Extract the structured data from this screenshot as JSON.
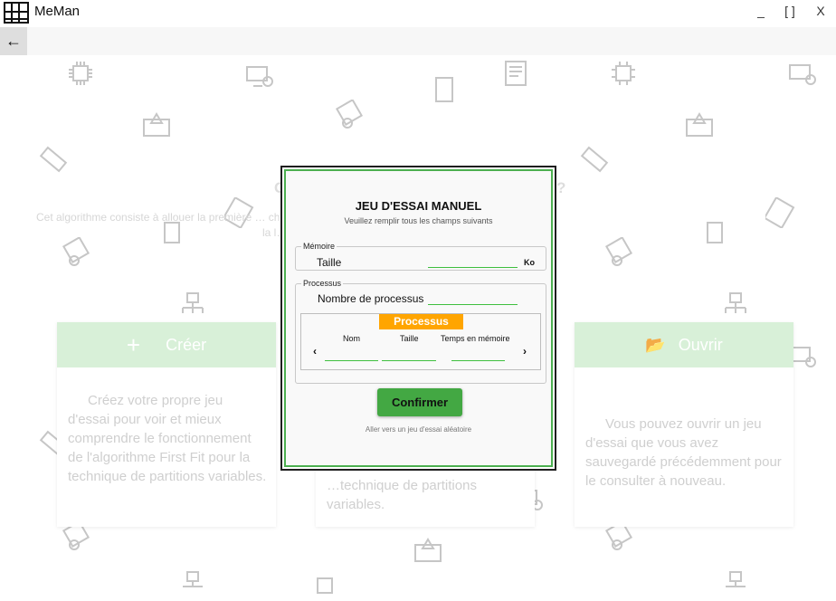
{
  "window": {
    "title": "MeMan",
    "minimize_label": "_",
    "maximize_label": "[ ]",
    "close_label": "X"
  },
  "nav": {
    "back_icon": "arrow-left-icon"
  },
  "background": {
    "heading_left": "C",
    "heading_right": "?",
    "desc_line1": "Cet algorithme consiste à allouer la première … charger en mémoire en la recherchant dans",
    "desc_line2": "la l… de."
  },
  "cards": [
    {
      "title": "Créer",
      "icon": "plus-icon",
      "body": "Créez votre propre jeu d'essai pour voir et mieux comprendre le fonctionnement de l'algorithme First Fit pour la technique de partitions variables."
    },
    {
      "title": "",
      "icon": "",
      "body": "…technique de partitions variables."
    },
    {
      "title": "Ouvrir",
      "icon": "folder-open-icon",
      "body": "Vous pouvez ouvrir un jeu d'essai que vous avez sauvegardé précédemment pour le consulter à nouveau."
    }
  ],
  "dialog": {
    "title": "JEU D'ESSAI MANUEL",
    "subtitle": "Veuillez remplir tous les champs suivants",
    "memory_group": "Mémoire",
    "size_label": "Taille",
    "size_value": "",
    "size_unit": "Ko",
    "process_group": "Processus",
    "process_count_label": "Nombre de processus",
    "process_count_value": "",
    "process_tag": "Processus",
    "col_name": "Nom",
    "col_size": "Taille",
    "col_time": "Temps en mémoire",
    "prev_arrow": "‹",
    "next_arrow": "›",
    "confirm_label": "Confirmer",
    "random_link": "Aller vers un jeu d'essai aléatoire"
  },
  "colors": {
    "accent_green": "#43a843",
    "orange": "#ffa500"
  }
}
